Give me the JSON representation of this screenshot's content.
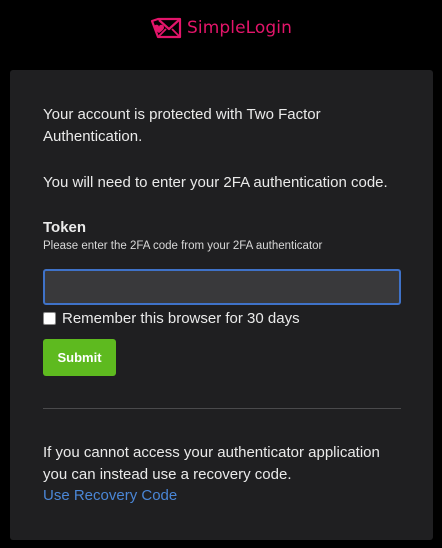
{
  "brand": {
    "name": "SimpleLogin",
    "accent_color": "#e3156a",
    "icon": "envelope-heart-icon"
  },
  "card": {
    "intro_text": "Your account is protected with Two Factor Authentication.",
    "instruction_text": "You will need to enter your 2FA authentication code.",
    "token_label": "Token",
    "token_help": "Please enter the 2FA code from your 2FA authenticator",
    "token_value": "",
    "token_placeholder": "",
    "remember_label": "Remember this browser for 30 days",
    "remember_checked": false,
    "submit_label": "Submit",
    "recovery_text": "If you cannot access your authenticator application you can instead use a recovery code.",
    "recovery_link_label": "Use Recovery Code"
  },
  "colors": {
    "background": "#000000",
    "card": "#1f1f21",
    "submit": "#5eba1f",
    "link": "#4a86d6",
    "input_border": "#3f72c8"
  }
}
